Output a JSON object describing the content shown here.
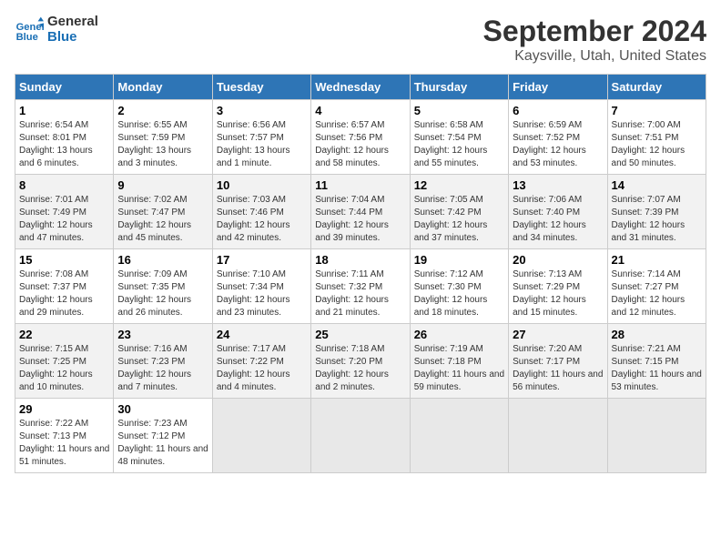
{
  "header": {
    "logo_line1": "General",
    "logo_line2": "Blue",
    "month": "September 2024",
    "location": "Kaysville, Utah, United States"
  },
  "days_of_week": [
    "Sunday",
    "Monday",
    "Tuesday",
    "Wednesday",
    "Thursday",
    "Friday",
    "Saturday"
  ],
  "weeks": [
    [
      {
        "day": "1",
        "sunrise": "6:54 AM",
        "sunset": "8:01 PM",
        "daylight": "13 hours and 6 minutes."
      },
      {
        "day": "2",
        "sunrise": "6:55 AM",
        "sunset": "7:59 PM",
        "daylight": "13 hours and 3 minutes."
      },
      {
        "day": "3",
        "sunrise": "6:56 AM",
        "sunset": "7:57 PM",
        "daylight": "13 hours and 1 minute."
      },
      {
        "day": "4",
        "sunrise": "6:57 AM",
        "sunset": "7:56 PM",
        "daylight": "12 hours and 58 minutes."
      },
      {
        "day": "5",
        "sunrise": "6:58 AM",
        "sunset": "7:54 PM",
        "daylight": "12 hours and 55 minutes."
      },
      {
        "day": "6",
        "sunrise": "6:59 AM",
        "sunset": "7:52 PM",
        "daylight": "12 hours and 53 minutes."
      },
      {
        "day": "7",
        "sunrise": "7:00 AM",
        "sunset": "7:51 PM",
        "daylight": "12 hours and 50 minutes."
      }
    ],
    [
      {
        "day": "8",
        "sunrise": "7:01 AM",
        "sunset": "7:49 PM",
        "daylight": "12 hours and 47 minutes."
      },
      {
        "day": "9",
        "sunrise": "7:02 AM",
        "sunset": "7:47 PM",
        "daylight": "12 hours and 45 minutes."
      },
      {
        "day": "10",
        "sunrise": "7:03 AM",
        "sunset": "7:46 PM",
        "daylight": "12 hours and 42 minutes."
      },
      {
        "day": "11",
        "sunrise": "7:04 AM",
        "sunset": "7:44 PM",
        "daylight": "12 hours and 39 minutes."
      },
      {
        "day": "12",
        "sunrise": "7:05 AM",
        "sunset": "7:42 PM",
        "daylight": "12 hours and 37 minutes."
      },
      {
        "day": "13",
        "sunrise": "7:06 AM",
        "sunset": "7:40 PM",
        "daylight": "12 hours and 34 minutes."
      },
      {
        "day": "14",
        "sunrise": "7:07 AM",
        "sunset": "7:39 PM",
        "daylight": "12 hours and 31 minutes."
      }
    ],
    [
      {
        "day": "15",
        "sunrise": "7:08 AM",
        "sunset": "7:37 PM",
        "daylight": "12 hours and 29 minutes."
      },
      {
        "day": "16",
        "sunrise": "7:09 AM",
        "sunset": "7:35 PM",
        "daylight": "12 hours and 26 minutes."
      },
      {
        "day": "17",
        "sunrise": "7:10 AM",
        "sunset": "7:34 PM",
        "daylight": "12 hours and 23 minutes."
      },
      {
        "day": "18",
        "sunrise": "7:11 AM",
        "sunset": "7:32 PM",
        "daylight": "12 hours and 21 minutes."
      },
      {
        "day": "19",
        "sunrise": "7:12 AM",
        "sunset": "7:30 PM",
        "daylight": "12 hours and 18 minutes."
      },
      {
        "day": "20",
        "sunrise": "7:13 AM",
        "sunset": "7:29 PM",
        "daylight": "12 hours and 15 minutes."
      },
      {
        "day": "21",
        "sunrise": "7:14 AM",
        "sunset": "7:27 PM",
        "daylight": "12 hours and 12 minutes."
      }
    ],
    [
      {
        "day": "22",
        "sunrise": "7:15 AM",
        "sunset": "7:25 PM",
        "daylight": "12 hours and 10 minutes."
      },
      {
        "day": "23",
        "sunrise": "7:16 AM",
        "sunset": "7:23 PM",
        "daylight": "12 hours and 7 minutes."
      },
      {
        "day": "24",
        "sunrise": "7:17 AM",
        "sunset": "7:22 PM",
        "daylight": "12 hours and 4 minutes."
      },
      {
        "day": "25",
        "sunrise": "7:18 AM",
        "sunset": "7:20 PM",
        "daylight": "12 hours and 2 minutes."
      },
      {
        "day": "26",
        "sunrise": "7:19 AM",
        "sunset": "7:18 PM",
        "daylight": "11 hours and 59 minutes."
      },
      {
        "day": "27",
        "sunrise": "7:20 AM",
        "sunset": "7:17 PM",
        "daylight": "11 hours and 56 minutes."
      },
      {
        "day": "28",
        "sunrise": "7:21 AM",
        "sunset": "7:15 PM",
        "daylight": "11 hours and 53 minutes."
      }
    ],
    [
      {
        "day": "29",
        "sunrise": "7:22 AM",
        "sunset": "7:13 PM",
        "daylight": "11 hours and 51 minutes."
      },
      {
        "day": "30",
        "sunrise": "7:23 AM",
        "sunset": "7:12 PM",
        "daylight": "11 hours and 48 minutes."
      },
      null,
      null,
      null,
      null,
      null
    ]
  ]
}
